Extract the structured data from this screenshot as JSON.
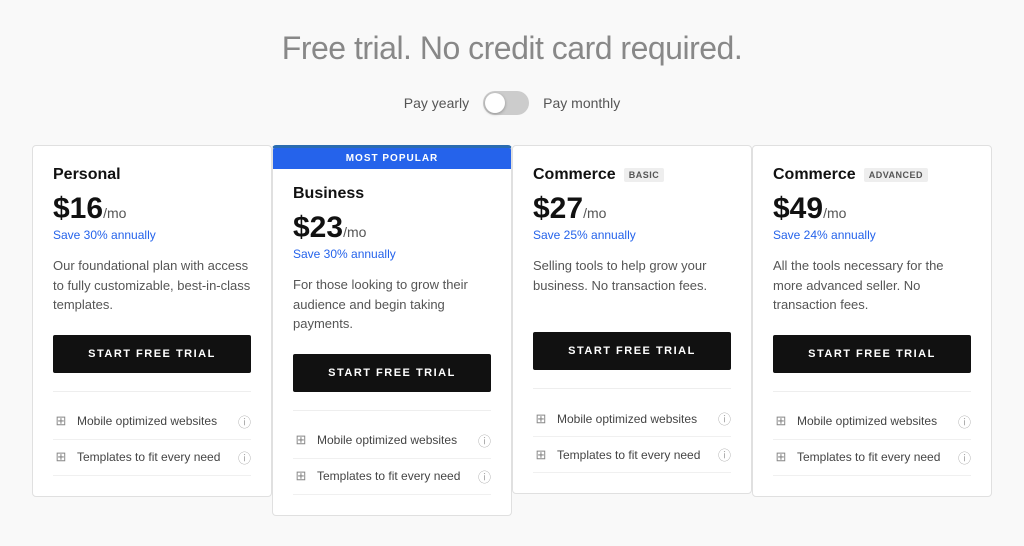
{
  "header": {
    "title": "Free trial. No credit card required."
  },
  "billing": {
    "yearly_label": "Pay yearly",
    "monthly_label": "Pay monthly"
  },
  "plans": [
    {
      "id": "personal",
      "name": "Personal",
      "tier_badge": null,
      "popular": false,
      "price": "$16",
      "period": "/mo",
      "savings": "Save 30% annually",
      "description": "Our foundational plan with access to fully customizable, best-in-class templates.",
      "cta": "START FREE TRIAL",
      "features": [
        {
          "text": "Mobile optimized websites"
        },
        {
          "text": "Templates to fit every need"
        }
      ]
    },
    {
      "id": "business",
      "name": "Business",
      "tier_badge": null,
      "popular": true,
      "popular_label": "MOST POPULAR",
      "price": "$23",
      "period": "/mo",
      "savings": "Save 30% annually",
      "description": "For those looking to grow their audience and begin taking payments.",
      "cta": "START FREE TRIAL",
      "features": [
        {
          "text": "Mobile optimized websites"
        },
        {
          "text": "Templates to fit every need"
        }
      ]
    },
    {
      "id": "commerce-basic",
      "name": "Commerce",
      "tier_badge": "BASIC",
      "popular": false,
      "price": "$27",
      "period": "/mo",
      "savings": "Save 25% annually",
      "description": "Selling tools to help grow your business. No transaction fees.",
      "cta": "START FREE TRIAL",
      "features": [
        {
          "text": "Mobile optimized websites"
        },
        {
          "text": "Templates to fit every need"
        }
      ]
    },
    {
      "id": "commerce-advanced",
      "name": "Commerce",
      "tier_badge": "ADVANCED",
      "popular": false,
      "price": "$49",
      "period": "/mo",
      "savings": "Save 24% annually",
      "description": "All the tools necessary for the more advanced seller. No transaction fees.",
      "cta": "START FREE TRIAL",
      "features": [
        {
          "text": "Mobile optimized websites"
        },
        {
          "text": "Templates to fit every need"
        }
      ]
    }
  ]
}
